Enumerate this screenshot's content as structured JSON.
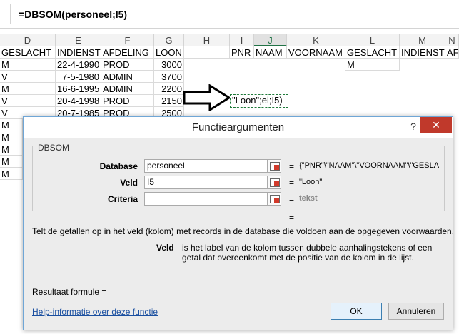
{
  "formula_bar": {
    "formula": "=DBSOM(personeel;I5)"
  },
  "columns": [
    "D",
    "E",
    "F",
    "G",
    "H",
    "I",
    "J",
    "K",
    "L",
    "M",
    "N"
  ],
  "headers_row": [
    "GESLACHT",
    "INDIENST",
    "AFDELING",
    "LOON",
    "",
    "PNR",
    "NAAM",
    "VOORNAAM",
    "GESLACHT",
    "INDIENST",
    "AF"
  ],
  "rows": [
    [
      "M",
      "22-4-1990",
      "PROD",
      "3000"
    ],
    [
      "V",
      "7-5-1980",
      "ADMIN",
      "3700"
    ],
    [
      "M",
      "16-6-1995",
      "ADMIN",
      "2200"
    ],
    [
      "V",
      "20-4-1998",
      "PROD",
      "2150"
    ],
    [
      "V",
      "20-7-1985",
      "PROD",
      "2500"
    ],
    [
      "M",
      "",
      "",
      ""
    ],
    [
      "M",
      "",
      "",
      ""
    ],
    [
      "M",
      "",
      "",
      ""
    ],
    [
      "M",
      "",
      "",
      ""
    ],
    [
      "M",
      "",
      "",
      ""
    ]
  ],
  "l2_value": "M",
  "active_cell_text": "\"Loon\";el;I5)",
  "dialog": {
    "title": "Functieargumenten",
    "minimize_icon": "?",
    "close_icon": "✕",
    "function_name": "DBSOM",
    "args": [
      {
        "label": "Database",
        "value": "personeel",
        "result": "{\"PNR\"\\\"NAAM\"\\\"VOORNAAM\"\\\"GESLA"
      },
      {
        "label": "Veld",
        "value": "I5",
        "result": "\"Loon\""
      },
      {
        "label": "Criteria",
        "value": "",
        "result": "tekst"
      }
    ],
    "eq_sign": "=",
    "function_result_eq": "=",
    "description": "Telt de getallen op in het veld (kolom) met records in de database die voldoen aan de opgegeven voorwaarden.",
    "arg_help_name": "Veld",
    "arg_help_text_1": "is het label van de kolom tussen dubbele aanhalingstekens of een",
    "arg_help_text_2": "getal dat overeenkomt met de positie van de kolom in de lijst.",
    "result_label": "Resultaat formule =",
    "help_link": "Help-informatie over deze functie",
    "ok_label": "OK",
    "cancel_label": "Annuleren"
  },
  "colors": {
    "accent": "#217346",
    "close": "#c0392b",
    "link": "#1a4fa0"
  }
}
